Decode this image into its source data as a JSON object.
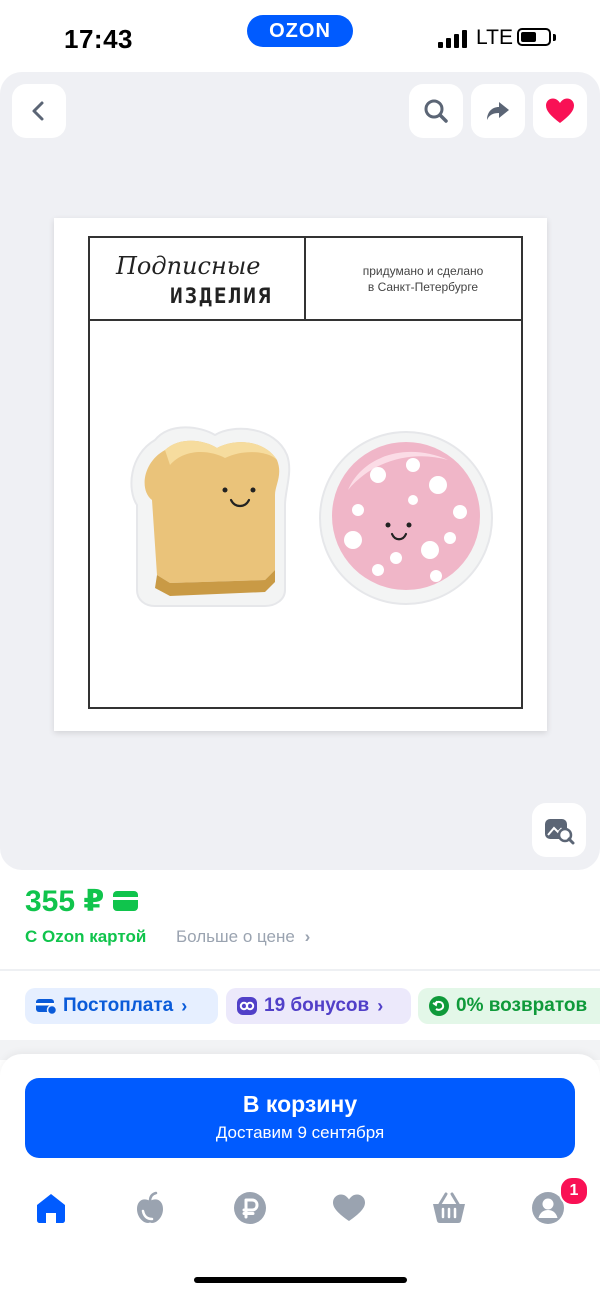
{
  "status_bar": {
    "time": "17:43",
    "app_badge": "OZON",
    "network": "LTE"
  },
  "gallery": {
    "brand_script": "Подписные",
    "brand_caps": "ИЗДЕЛИЯ",
    "made_line1": "придумано и сделано",
    "made_line2": "в Санкт-Петербурге"
  },
  "price": {
    "value": "355 ₽",
    "ozon_card_label": "С Ozon картой",
    "more_label": "Больше о цене",
    "more_chevron": "›"
  },
  "chips": [
    {
      "label": "Постоплата",
      "chevron": "›"
    },
    {
      "label": "19 бонусов",
      "chevron": "›"
    },
    {
      "label": "0% возвратов"
    }
  ],
  "cart": {
    "title": "В корзину",
    "subtitle": "Доставим 9 сентября"
  },
  "nav": {
    "items": [
      "home-icon",
      "fresh-icon",
      "ruble-icon",
      "favorites-icon",
      "cart-icon",
      "profile-icon"
    ],
    "profile_badge": "1",
    "active_color": "#005bff",
    "inactive_color": "#9aa3b0"
  },
  "colors": {
    "accent": "#005bff",
    "price_green": "#10c44c",
    "favorite_pink": "#f91155"
  }
}
